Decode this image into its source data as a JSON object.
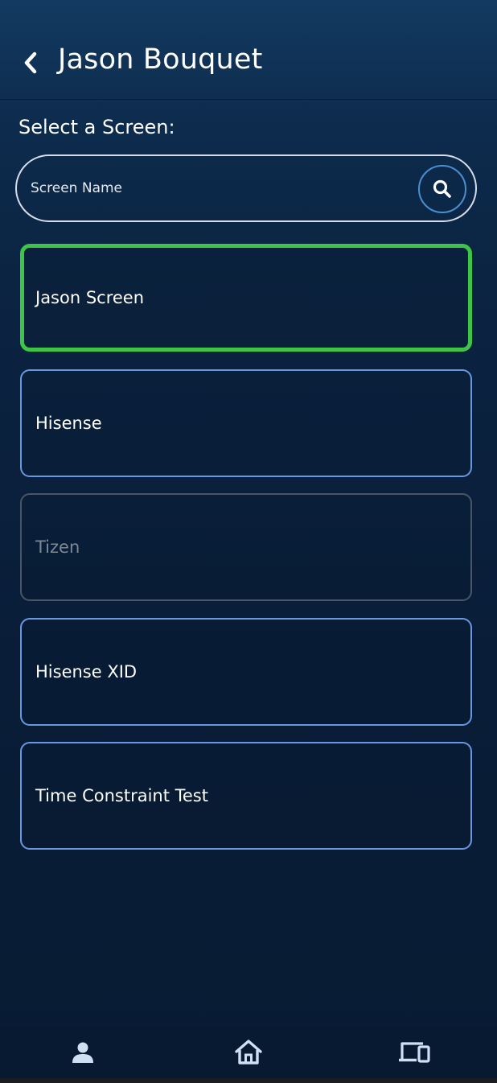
{
  "header": {
    "title": "Jason Bouquet",
    "back_icon": "chevron-left-icon"
  },
  "search": {
    "label": "Select a Screen:",
    "placeholder": "Screen Name",
    "value": "",
    "button_icon": "search-icon"
  },
  "screens": [
    {
      "label": "Jason Screen",
      "state": "selected"
    },
    {
      "label": "Hisense",
      "state": "available"
    },
    {
      "label": "Tizen",
      "state": "disabled"
    },
    {
      "label": "Hisense XID",
      "state": "available"
    },
    {
      "label": "Time Constraint Test",
      "state": "available"
    }
  ],
  "bottom_nav": {
    "items": [
      {
        "icon": "person-icon"
      },
      {
        "icon": "home-icon"
      },
      {
        "icon": "devices-icon"
      }
    ]
  },
  "colors": {
    "selected_border": "#3ec548",
    "available_border": "#6a98e0",
    "disabled_border": "#4a5566",
    "search_button_ring": "#4b8ed0",
    "icon_color": "#cfe0f3"
  }
}
